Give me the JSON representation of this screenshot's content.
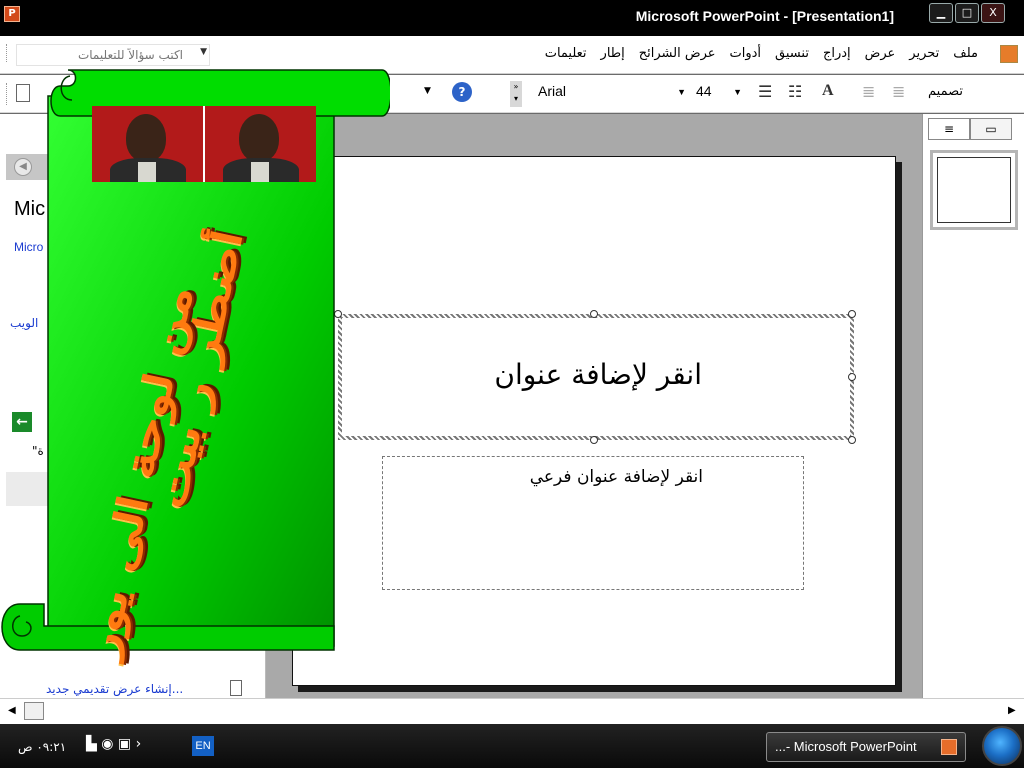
{
  "window": {
    "title": "Microsoft PowerPoint - [Presentation1]",
    "app_icon": "P",
    "controls": {
      "minimize": "▁",
      "maximize": "□",
      "close": "X"
    }
  },
  "menu": {
    "items": [
      "ملف",
      "تحرير",
      "عرض",
      "إدراج",
      "تنسيق",
      "أدوات",
      "عرض الشرائح",
      "إطار",
      "تعليمات"
    ],
    "help_placeholder": "اكتب سؤالاً للتعليمات"
  },
  "toolbar": {
    "font_name": "Arial",
    "font_size": "44",
    "design_label": "تصميم",
    "help_glyph": "?"
  },
  "task_pane": {
    "heading": "Mic",
    "link_micro": "Micro",
    "web_text": "الويب",
    "quote_text": "\"ة",
    "new_presentation": "إنشاء عرض تقديمي جديد..."
  },
  "slide": {
    "title_placeholder": "انقر لإضافة عنوان",
    "subtitle_placeholder": "انقر لإضافة عنوان فرعي"
  },
  "overlay": {
    "line1": "أضطر ر بيت",
    "line2": "من لوحة الى يور"
  },
  "taskbar": {
    "clock": "٠٩:٢١ ص",
    "language": "EN",
    "task_label": "...- Microsoft PowerPoint"
  },
  "colors": {
    "scroll_green": "#00c000",
    "scroll_text": "#ff7a10",
    "title_bar": "#000000"
  }
}
